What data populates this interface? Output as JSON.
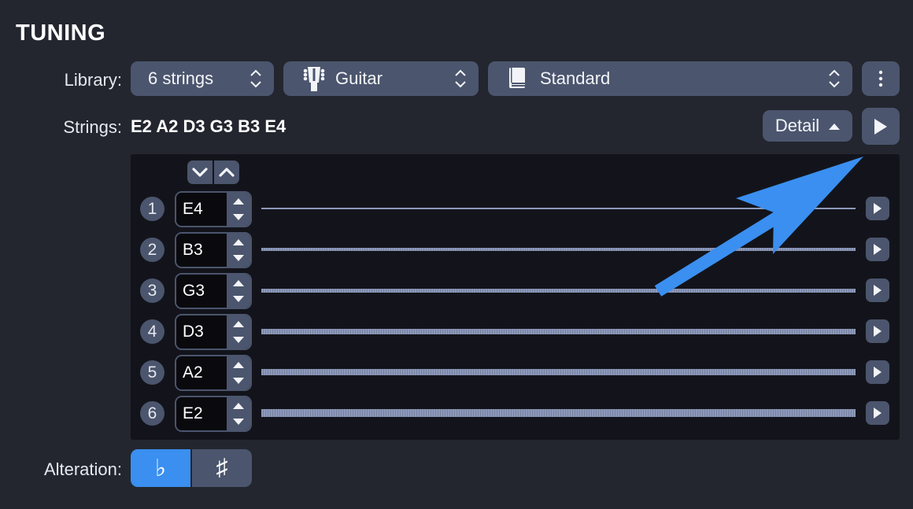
{
  "header": {
    "title": "TUNING"
  },
  "library": {
    "label": "Library:",
    "strings_count": "6 strings",
    "instrument": "Guitar",
    "tuning": "Standard"
  },
  "strings_row": {
    "label": "Strings:",
    "value": "E2 A2 D3 G3 B3 E4",
    "detail_label": "Detail"
  },
  "strings": [
    {
      "number": "1",
      "note": "E4"
    },
    {
      "number": "2",
      "note": "B3"
    },
    {
      "number": "3",
      "note": "G3"
    },
    {
      "number": "4",
      "note": "D3"
    },
    {
      "number": "5",
      "note": "A2"
    },
    {
      "number": "6",
      "note": "E2"
    }
  ],
  "alteration": {
    "label": "Alteration:",
    "flat": "♭",
    "sharp": "♯",
    "selected": "flat"
  },
  "colors": {
    "background": "#23262f",
    "control": "#4b556d",
    "panel": "#13141b",
    "accent": "#3a8ff0",
    "string": "#8d99bb"
  },
  "icons": {
    "updown": "chevron-updown-icon",
    "guitar": "guitar-head-icon",
    "book": "book-icon",
    "more": "more-vertical-icon",
    "play": "play-icon"
  }
}
